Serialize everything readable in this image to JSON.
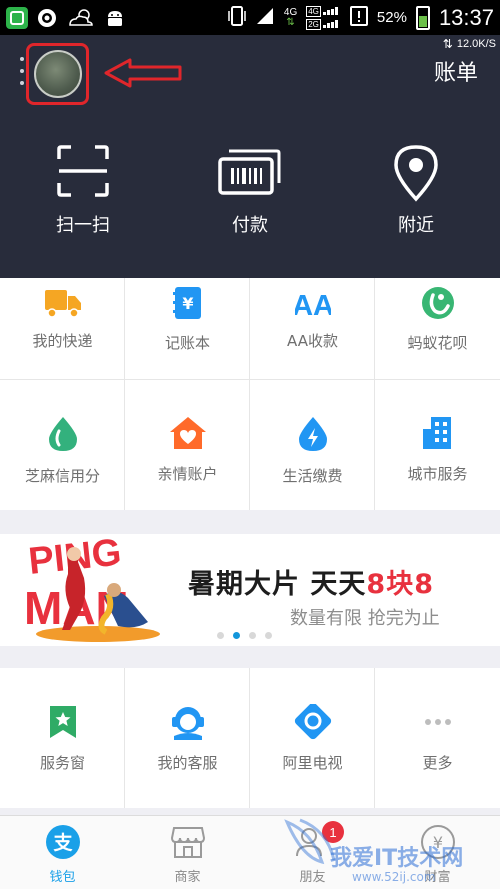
{
  "status_bar": {
    "signal_4g": "4G",
    "signal_2g": "2G",
    "battery": "52%",
    "battery_level": 0.52,
    "time": "13:37"
  },
  "header": {
    "net_speed": "12.0K/S",
    "bill_label": "账单",
    "actions": [
      {
        "label": "扫一扫",
        "icon": "scan-icon"
      },
      {
        "label": "付款",
        "icon": "barcode-icon"
      },
      {
        "label": "附近",
        "icon": "location-pin-icon"
      }
    ]
  },
  "grid1": [
    {
      "label": "我的快递",
      "icon": "delivery-truck-icon",
      "color": "#f5a623"
    },
    {
      "label": "记账本",
      "icon": "yuan-book-icon",
      "color": "#2196f3"
    },
    {
      "label": "AA收款",
      "icon": "aa-icon",
      "color": "#2196f3"
    },
    {
      "label": "蚂蚁花呗",
      "icon": "huabei-icon",
      "color": "#38b673"
    },
    {
      "label": "芝麻信用分",
      "icon": "sesame-drop-icon",
      "color": "#33b17d"
    },
    {
      "label": "亲情账户",
      "icon": "heart-house-icon",
      "color": "#ff6a2a"
    },
    {
      "label": "生活缴费",
      "icon": "bolt-drop-icon",
      "color": "#2196f3"
    },
    {
      "label": "城市服务",
      "icon": "building-icon",
      "color": "#2196f3"
    }
  ],
  "banner": {
    "title_main": "暑期大片 天天",
    "title_highlight": "8块8",
    "subtitle": "数量有限  抢完为止",
    "logo_text": "PING MAN"
  },
  "grid2": [
    {
      "label": "服务窗",
      "icon": "service-window-icon",
      "color": "#2fab66"
    },
    {
      "label": "我的客服",
      "icon": "customer-service-icon",
      "color": "#2196f3"
    },
    {
      "label": "阿里电视",
      "icon": "tv-icon",
      "color": "#2196f3"
    },
    {
      "label": "更多",
      "icon": "more-dots-icon",
      "color": "#bdbdbd"
    }
  ],
  "tabs": [
    {
      "label": "钱包",
      "icon": "wallet-icon",
      "active": true
    },
    {
      "label": "商家",
      "icon": "shop-icon",
      "active": false
    },
    {
      "label": "朋友",
      "icon": "friends-icon",
      "active": false,
      "badge": "1"
    },
    {
      "label": "财富",
      "icon": "wealth-icon",
      "active": false
    }
  ],
  "watermark": {
    "text": "我爱IT技术网",
    "url": "www.52ij.com"
  },
  "colors": {
    "header_bg": "#282c3b",
    "accent_blue": "#1aa0e8",
    "highlight_red": "#e8313e",
    "annotation_red": "#e0262b"
  }
}
